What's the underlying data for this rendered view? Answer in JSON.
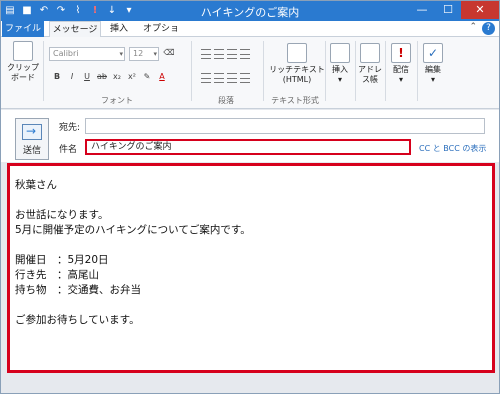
{
  "window": {
    "title": "ハイキングのご案内"
  },
  "tabs": {
    "file": "ファイル",
    "message": "メッセージ",
    "insert": "挿入",
    "options": "オプション"
  },
  "ribbon": {
    "clipboard_label_1": "クリップ",
    "clipboard_label_2": "ボード",
    "font_name": "Calibri",
    "font_size": "12",
    "font_group": "フォント",
    "paragraph_group": "段落",
    "richtext_label_1": "リッチテキスト",
    "richtext_label_2": "(HTML)",
    "textformat_group": "テキスト形式",
    "insert": "挿入",
    "addressbook_1": "アドレ",
    "addressbook_2": "ス帳",
    "delivery": "配信",
    "edit": "編集"
  },
  "header": {
    "send": "送信",
    "to_label": "宛先:",
    "to_value": "",
    "subject_label": "件名",
    "subject_value": "ハイキングのご案内",
    "cc_bcc": "CC と BCC の表示"
  },
  "body": {
    "text": "秋葉さん\n\nお世話になります。\n5月に開催予定のハイキングについてご案内です。\n\n開催日　：5月20日\n行き先　：高尾山\n持ち物　：交通費、お弁当\n\nご参加お待ちしています。"
  }
}
